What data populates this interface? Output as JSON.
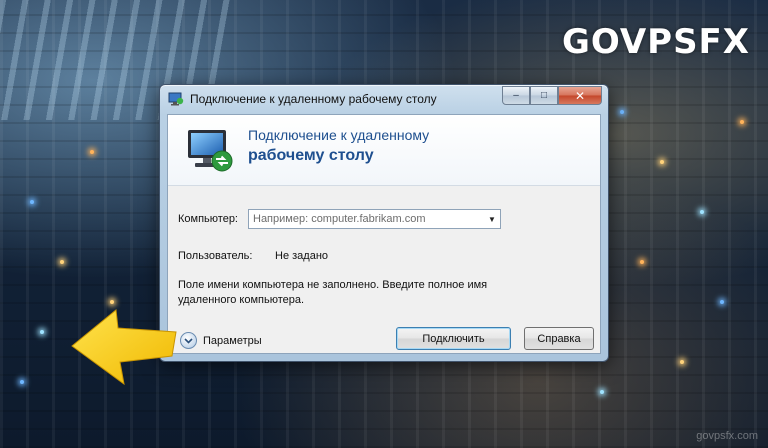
{
  "brand": {
    "logo_text": "GOVPSFX",
    "watermark": "govpsfx.com"
  },
  "window": {
    "title": "Подключение к удаленному рабочему столу",
    "controls": {
      "minimize": "–",
      "maximize": "□",
      "close": "✕"
    }
  },
  "banner": {
    "line1": "Подключение к удаленному",
    "line2": "рабочему столу"
  },
  "form": {
    "computer_label": "Компьютер:",
    "computer_placeholder": "Например: computer.fabrikam.com",
    "user_label": "Пользователь:",
    "user_value": "Не задано",
    "message": "Поле имени компьютера не заполнено. Введите полное имя удаленного компьютера."
  },
  "footer": {
    "options_label": "Параметры",
    "connect_label": "Подключить",
    "help_label": "Справка"
  },
  "colors": {
    "accent": "#1e4f8f",
    "arrow": "#f5c518",
    "logo_v": "#f08a1c"
  },
  "icons": {
    "title_icon": "remote-desktop-icon",
    "banner_icon": "remote-desktop-icon",
    "options_icon": "chevron-down-icon",
    "pointer": "yellow-arrow-icon"
  }
}
